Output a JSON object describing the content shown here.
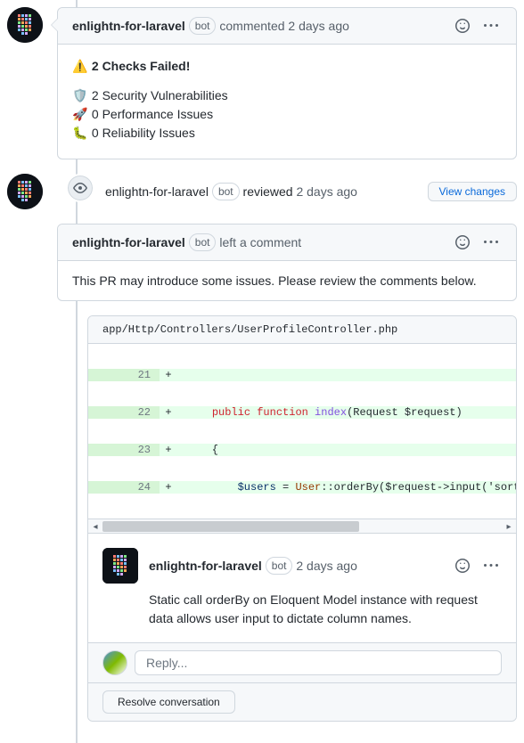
{
  "author": "enlightn-for-laravel",
  "bot_label": "bot",
  "comment1": {
    "verb": "commented",
    "time": "2 days ago",
    "checks_failed": "2 Checks Failed!",
    "security": "2 Security Vulnerabilities",
    "performance": "0 Performance Issues",
    "reliability": "0 Reliability Issues"
  },
  "review": {
    "verb": "reviewed",
    "time": "2 days ago",
    "view_changes": "View changes",
    "left_comment": "left a comment",
    "body": "This PR may introduce some issues. Please review the comments below."
  },
  "file": {
    "path": "app/Http/Controllers/UserProfileController.php",
    "lines": [
      {
        "n": "21",
        "sym": "+",
        "code": ""
      },
      {
        "n": "22",
        "sym": "+",
        "code_html": true
      },
      {
        "n": "23",
        "sym": "+",
        "code": "    {"
      },
      {
        "n": "24",
        "sym": "+",
        "code_html": true
      }
    ],
    "l22_kw1": "public",
    "l22_kw2": "function",
    "l22_fn": "index",
    "l22_rest": "(Request $request)",
    "l24_var": "$users",
    "l24_eq": " = ",
    "l24_cls": "User",
    "l24_rest": "::orderBy($request->input('sortBy"
  },
  "inline_comment": {
    "time": "2 days ago",
    "body": "Static call orderBy on Eloquent Model instance with request data allows user input to dictate column names."
  },
  "reply_placeholder": "Reply...",
  "resolve_label": "Resolve conversation"
}
